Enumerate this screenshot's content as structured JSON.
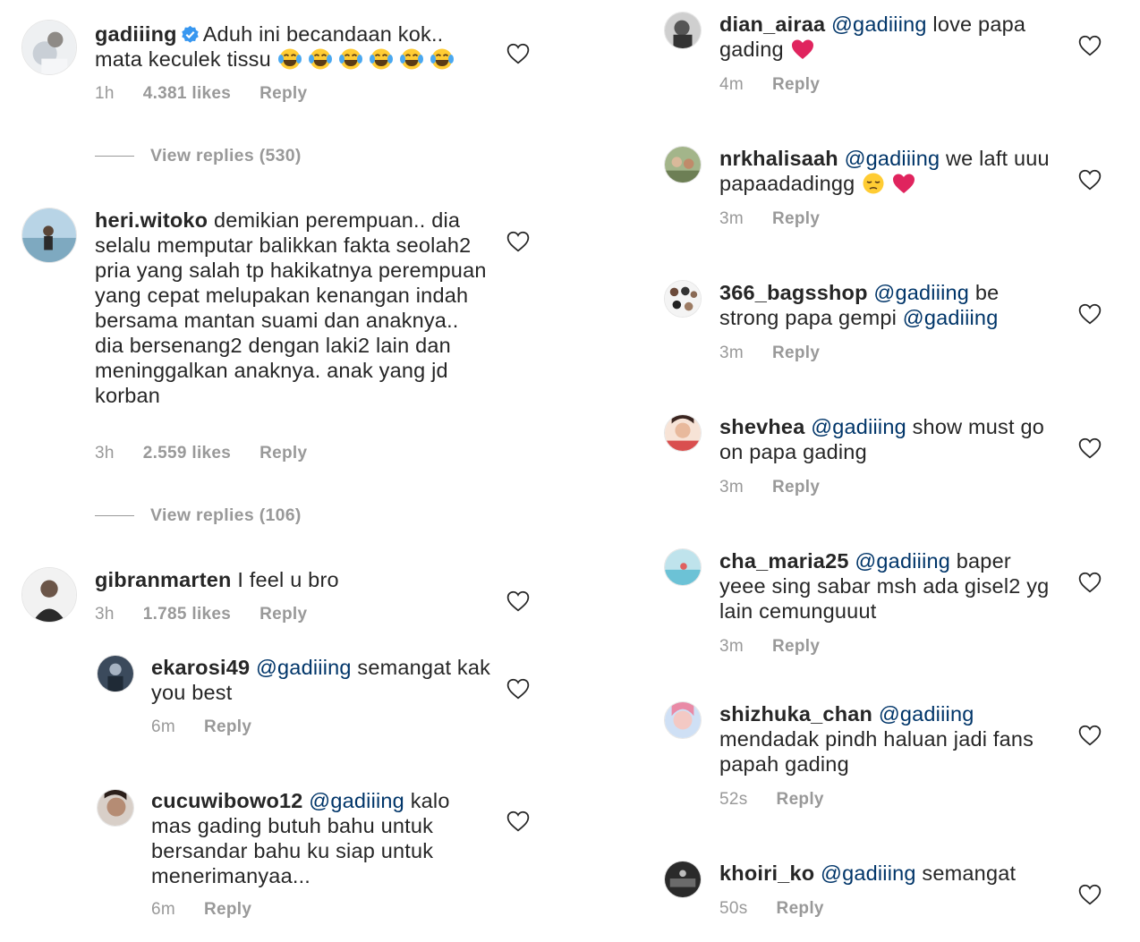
{
  "left": {
    "c1": {
      "user": "gadiiing",
      "text": "Aduh ini becandaan kok.. mata keculek tissu",
      "emoji_count": 6,
      "time": "1h",
      "likes": "4.381 likes",
      "reply": "Reply"
    },
    "vr1": "View replies (530)",
    "c2": {
      "user": "heri.witoko",
      "text": "demikian perempuan.. dia selalu memputar balikkan fakta seolah2 pria yang salah tp hakikatnya perempuan yang cepat melupakan kenangan indah bersama mantan suami dan anaknya.. dia bersenang2 dengan laki2 lain dan meninggalkan anaknya. anak yang jd korban",
      "time": "3h",
      "likes": "2.559 likes",
      "reply": "Reply"
    },
    "vr2": "View replies (106)",
    "c3": {
      "user": "gibranmarten",
      "text": "I feel u bro",
      "time": "3h",
      "likes": "1.785 likes",
      "reply": "Reply"
    },
    "c4": {
      "user": "ekarosi49",
      "mention": "@gadiiing",
      "text": "semangat kak you best",
      "time": "6m",
      "reply": "Reply"
    },
    "c5": {
      "user": "cucuwibowo12",
      "mention": "@gadiiing",
      "text": "kalo mas gading butuh bahu untuk bersandar bahu ku siap untuk menerimanyaa...",
      "time": "6m",
      "reply": "Reply"
    }
  },
  "right": {
    "r1": {
      "user": "dian_airaa",
      "mention": "@gadiiing",
      "text": "love papa gading",
      "time": "4m",
      "reply": "Reply"
    },
    "r2": {
      "user": "nrkhalisaah",
      "mention": "@gadiiing",
      "text": "we laft uuu papaadadingg",
      "time": "3m",
      "reply": "Reply"
    },
    "r3": {
      "user": "366_bagsshop",
      "mention": "@gadiiing",
      "text": "be strong papa gempi",
      "mention2": "@gadiiing",
      "time": "3m",
      "reply": "Reply"
    },
    "r4": {
      "user": "shevhea",
      "mention": "@gadiiing",
      "text": "show must go on papa gading",
      "time": "3m",
      "reply": "Reply"
    },
    "r5": {
      "user": "cha_maria25",
      "mention": "@gadiiing",
      "text": "baper yeee sing sabar msh ada gisel2 yg lain cemunguuut",
      "time": "3m",
      "reply": "Reply"
    },
    "r6": {
      "user": "shizhuka_chan",
      "mention": "@gadiiing",
      "text": "mendadak pindh haluan jadi fans papah gading",
      "time": "52s",
      "reply": "Reply"
    },
    "r7": {
      "user": "khoiri_ko",
      "mention": "@gadiiing",
      "text": "semangat",
      "time": "50s",
      "reply": "Reply"
    }
  },
  "icons": {
    "like": "heart-outline-icon",
    "verified": "verified-badge-icon",
    "laugh": "face-with-tears-of-joy-emoji",
    "heart_red": "red-heart-emoji",
    "pensive": "pensive-face-emoji"
  },
  "colors": {
    "text": "#262626",
    "mention": "#003569",
    "muted": "#999999",
    "verified": "#3897f0",
    "heart": "#e0245e"
  }
}
